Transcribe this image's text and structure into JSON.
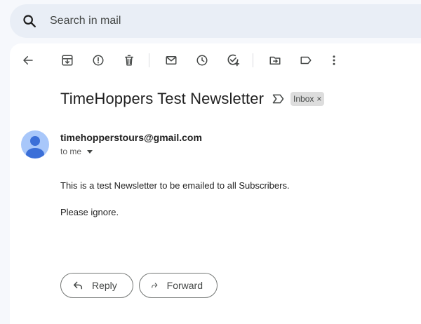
{
  "search": {
    "placeholder": "Search in mail"
  },
  "toolbar": {
    "items": [
      {
        "name": "back-arrow-icon"
      },
      {
        "name": "archive-icon"
      },
      {
        "name": "report-spam-icon"
      },
      {
        "name": "delete-icon"
      },
      {
        "name": "mark-unread-icon"
      },
      {
        "name": "snooze-icon"
      },
      {
        "name": "add-task-icon"
      },
      {
        "name": "move-to-icon"
      },
      {
        "name": "label-icon"
      },
      {
        "name": "more-vert-icon"
      }
    ]
  },
  "message": {
    "subject": "TimeHoppers Test Newsletter",
    "label": "Inbox",
    "label_close": "×",
    "sender": "timehopperstours@gmail.com",
    "recipient": "to me",
    "body": [
      "This is a test Newsletter to be emailed to all Subscribers.",
      "Please ignore."
    ]
  },
  "actions": {
    "reply": "Reply",
    "forward": "Forward"
  },
  "colors": {
    "background": "#f6f8fc",
    "search_bg": "#e9eef6",
    "avatar_bg": "#a8c7fa",
    "avatar_fg": "#3b6fd8"
  }
}
